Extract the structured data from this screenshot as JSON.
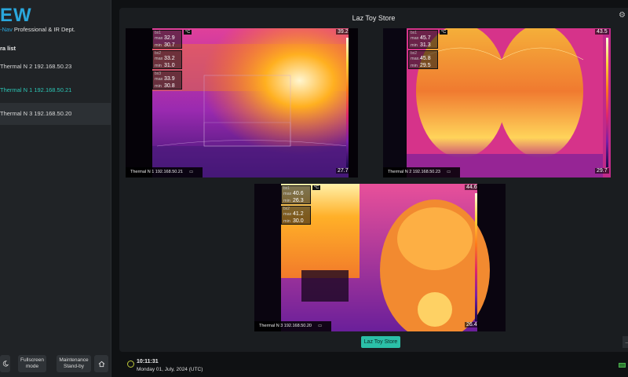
{
  "sidebar": {
    "logo": "EW",
    "tagline_accent": "-Nav",
    "tagline_rest": " Professional & IR Dept.",
    "camera_list_title": "ra list",
    "cameras": [
      {
        "label": "Thermal N 2 192.168.50.23"
      },
      {
        "label": "Thermal N 1 192.168.50.21"
      },
      {
        "label": "Thermal N 3 192.168.50.20"
      }
    ],
    "buttons": {
      "fullscreen": "Fullscreen mode",
      "maintenance": "Maintenance Stand-by"
    }
  },
  "main": {
    "title": "Laz Toy Store",
    "store_button": "Laz Toy Store",
    "unit": "°C",
    "feeds": [
      {
        "label": "Thermal N 1 192.168.50.21",
        "scale_max": "39.2",
        "scale_min": "27.7",
        "rois": [
          {
            "name": "bx1",
            "max": "32.9",
            "min": "30.7"
          },
          {
            "name": "bx2",
            "max": "33.2",
            "min": "31.0"
          },
          {
            "name": "bx3",
            "max": "33.9",
            "min": "30.8"
          }
        ]
      },
      {
        "label": "Thermal N 2 192.168.50.23",
        "scale_max": "43.5",
        "scale_min": "29.7",
        "rois": [
          {
            "name": "bx1",
            "max": "45.7",
            "min": "31.3"
          },
          {
            "name": "bx2",
            "max": "45.8",
            "min": "29.5"
          }
        ]
      },
      {
        "label": "Thermal N 3 192.168.50.20",
        "scale_max": "44.6",
        "scale_min": "26.4",
        "rois": [
          {
            "name": "bx1",
            "max": "40.6",
            "min": "26.3"
          },
          {
            "name": "bx2",
            "max": "41.2",
            "min": "30.0"
          }
        ]
      }
    ]
  },
  "status": {
    "time": "10:11:31",
    "date": "Monday 01, July, 2024 (UTC)"
  },
  "labels": {
    "max": "max",
    "min": "min"
  },
  "colors": {
    "accent": "#2aa7dc",
    "active": "#2bc4b4",
    "store_button": "#2bbfa7"
  }
}
